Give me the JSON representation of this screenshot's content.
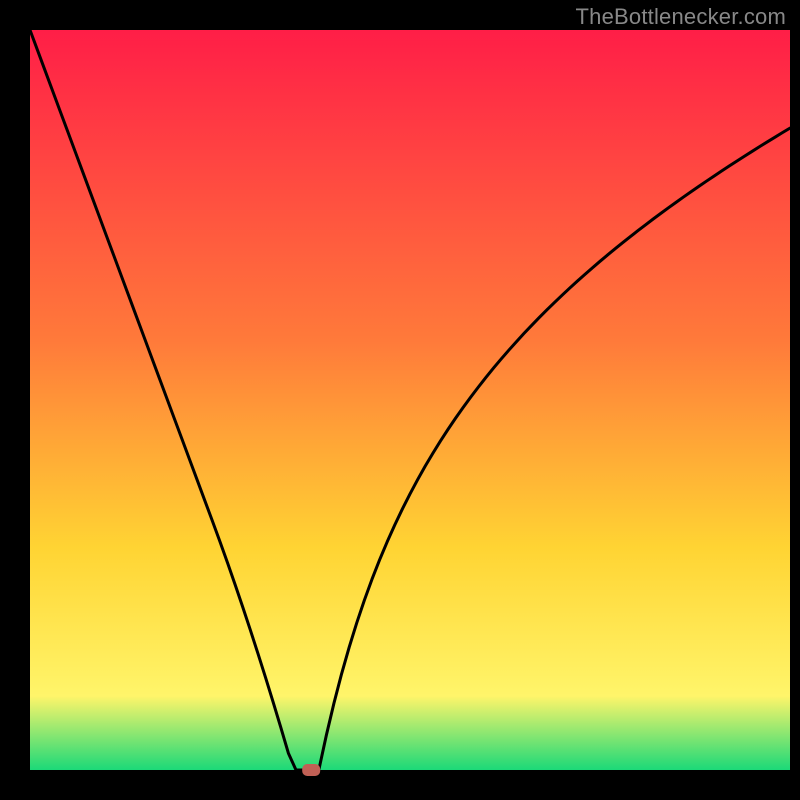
{
  "attribution": "TheBottlenecker.com",
  "chart_data": {
    "type": "line",
    "title": "",
    "xlabel": "",
    "ylabel": "",
    "xlim": [
      0,
      100
    ],
    "ylim": [
      0,
      100
    ],
    "x": [
      0,
      1,
      2,
      3,
      4,
      5,
      6,
      7,
      8,
      9,
      10,
      11,
      12,
      13,
      14,
      15,
      16,
      17,
      18,
      19,
      20,
      21,
      22,
      23,
      24,
      25,
      26,
      27,
      28,
      29,
      30,
      31,
      32,
      33,
      34,
      35,
      36,
      37,
      38,
      39,
      40,
      41,
      42,
      43,
      44,
      45,
      46,
      47,
      48,
      49,
      50,
      51,
      52,
      53,
      54,
      55,
      56,
      57,
      58,
      59,
      60,
      61,
      62,
      63,
      64,
      65,
      66,
      67,
      68,
      69,
      70,
      71,
      72,
      73,
      74,
      75,
      76,
      77,
      78,
      79,
      80,
      81,
      82,
      83,
      84,
      85,
      86,
      87,
      88,
      89,
      90,
      91,
      92,
      93,
      94,
      95,
      96,
      97,
      98,
      99,
      100
    ],
    "values": [
      100,
      97.24,
      94.47,
      91.71,
      88.94,
      86.18,
      83.41,
      80.65,
      77.88,
      75.12,
      72.35,
      69.59,
      66.82,
      64.06,
      61.29,
      58.53,
      55.76,
      53,
      50.24,
      47.47,
      44.71,
      41.94,
      39.18,
      36.41,
      33.65,
      30.85,
      27.97,
      25.02,
      21.99,
      18.89,
      15.72,
      12.47,
      9.14,
      5.75,
      2.27,
      0,
      0,
      0,
      0,
      4.73,
      9.05,
      13,
      16.6,
      19.91,
      22.96,
      25.78,
      28.4,
      30.84,
      33.13,
      35.28,
      37.31,
      39.23,
      41.06,
      42.79,
      44.45,
      46.03,
      47.55,
      49.01,
      50.41,
      51.76,
      53.06,
      54.33,
      55.55,
      56.73,
      57.88,
      59,
      60.08,
      61.14,
      62.17,
      63.17,
      64.15,
      65.11,
      66.05,
      66.96,
      67.86,
      68.74,
      69.6,
      70.45,
      71.28,
      72.09,
      72.89,
      73.68,
      74.46,
      75.22,
      75.97,
      76.71,
      77.44,
      78.16,
      78.87,
      79.57,
      80.26,
      80.94,
      81.62,
      82.28,
      82.94,
      83.59,
      84.24,
      84.87,
      85.5,
      86.13,
      86.74
    ],
    "background_gradient": {
      "top": "#ff1e47",
      "mid1": "#ff7a3a",
      "mid2": "#ffd433",
      "mid3": "#fff56a",
      "bottom": "#1bd978"
    },
    "marker": {
      "x": 37,
      "y_baseline": true,
      "color": "#c06055"
    },
    "curve_color": "#000000"
  }
}
